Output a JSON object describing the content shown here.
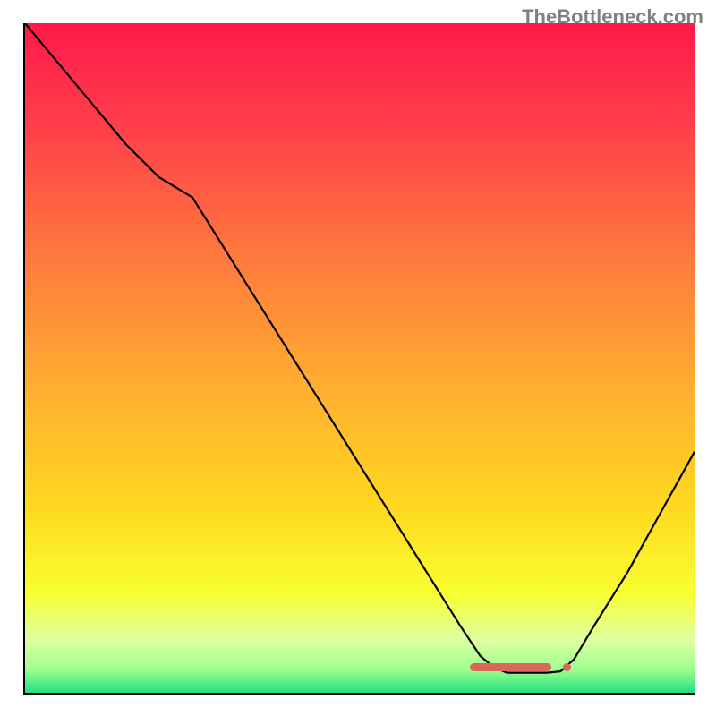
{
  "watermark": "TheBottleneck.com",
  "colors": {
    "gradient_stops": [
      {
        "offset": 0.0,
        "color": "#ff1a4a"
      },
      {
        "offset": 0.15,
        "color": "#ff3e4a"
      },
      {
        "offset": 0.35,
        "color": "#ff7a3e"
      },
      {
        "offset": 0.55,
        "color": "#ffb030"
      },
      {
        "offset": 0.72,
        "color": "#ffd820"
      },
      {
        "offset": 0.85,
        "color": "#f9ff30"
      },
      {
        "offset": 0.92,
        "color": "#e0ffa0"
      },
      {
        "offset": 0.965,
        "color": "#a0ff90"
      },
      {
        "offset": 1.0,
        "color": "#20e080"
      }
    ],
    "curve": "#000000",
    "marker": "#d9675a",
    "axis": "#000000"
  },
  "chart_data": {
    "type": "line",
    "title": "",
    "xlabel": "",
    "ylabel": "",
    "x": [
      0,
      5,
      10,
      15,
      20,
      25,
      30,
      35,
      40,
      45,
      50,
      55,
      60,
      65,
      68,
      70,
      72,
      74,
      76,
      78,
      80,
      82,
      85,
      90,
      95,
      100
    ],
    "values": [
      100,
      94,
      88,
      82,
      77,
      74,
      66,
      58,
      50,
      42,
      34,
      26,
      18,
      10,
      5.5,
      3.8,
      3.0,
      3.0,
      3.0,
      3.0,
      3.2,
      5,
      10,
      18,
      27,
      36
    ],
    "xlim": [
      0,
      100
    ],
    "ylim": [
      0,
      100
    ],
    "marker_segment": {
      "x_start": 67,
      "x_end": 81,
      "y": 3.8
    }
  }
}
